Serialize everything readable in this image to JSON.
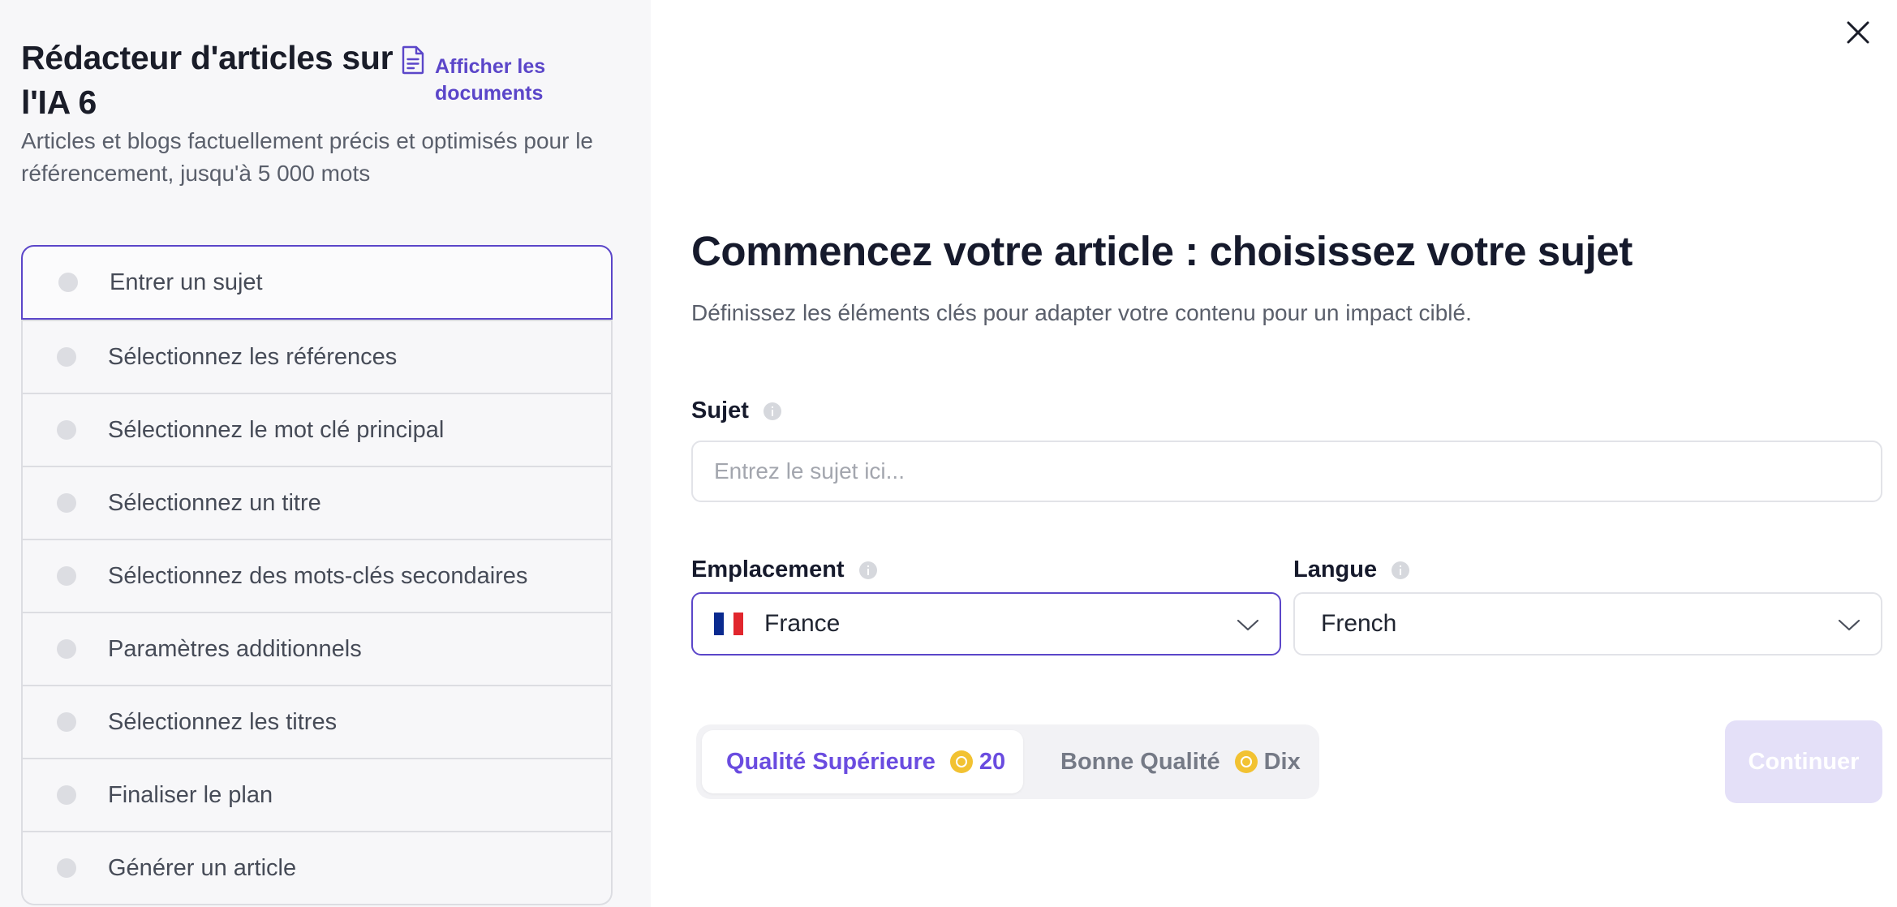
{
  "app": {
    "title": "Rédacteur d'articles sur l'IA 6",
    "subtitle": "Articles et blogs factuellement précis et optimisés pour le référencement, jusqu'à 5 000 mots",
    "docs_link_label": "Afficher les documents",
    "docs_icon": "document-icon"
  },
  "steps": [
    {
      "label": "Entrer un sujet",
      "active": true
    },
    {
      "label": "Sélectionnez les références",
      "active": false
    },
    {
      "label": "Sélectionnez le mot clé principal",
      "active": false
    },
    {
      "label": "Sélectionnez un titre",
      "active": false
    },
    {
      "label": "Sélectionnez des mots-clés secondaires",
      "active": false
    },
    {
      "label": "Paramètres additionnels",
      "active": false
    },
    {
      "label": "Sélectionnez les titres",
      "active": false
    },
    {
      "label": "Finaliser le plan",
      "active": false
    },
    {
      "label": "Générer un article",
      "active": false
    }
  ],
  "main": {
    "headline": "Commencez votre article : choisissez votre sujet",
    "lead": "Définissez les éléments clés pour adapter votre contenu pour un impact ciblé.",
    "subject": {
      "label": "Sujet",
      "value": "",
      "placeholder": "Entrez le sujet ici..."
    },
    "location": {
      "label": "Emplacement",
      "value": "France",
      "flag": "french-flag"
    },
    "language": {
      "label": "Langue",
      "value": "French"
    },
    "quality": [
      {
        "label": "Qualité Supérieure",
        "cost": "20",
        "selected": true
      },
      {
        "label": "Bonne Qualité",
        "cost": "Dix",
        "selected": false
      }
    ],
    "continue_label": "Continuer"
  },
  "colors": {
    "accent": "#5b46c9",
    "accent_text": "#6a4ce0",
    "coin": "#f2c232",
    "continue_disabled": "#e4e0f8",
    "left_panel_bg": "#f7f7f9"
  }
}
